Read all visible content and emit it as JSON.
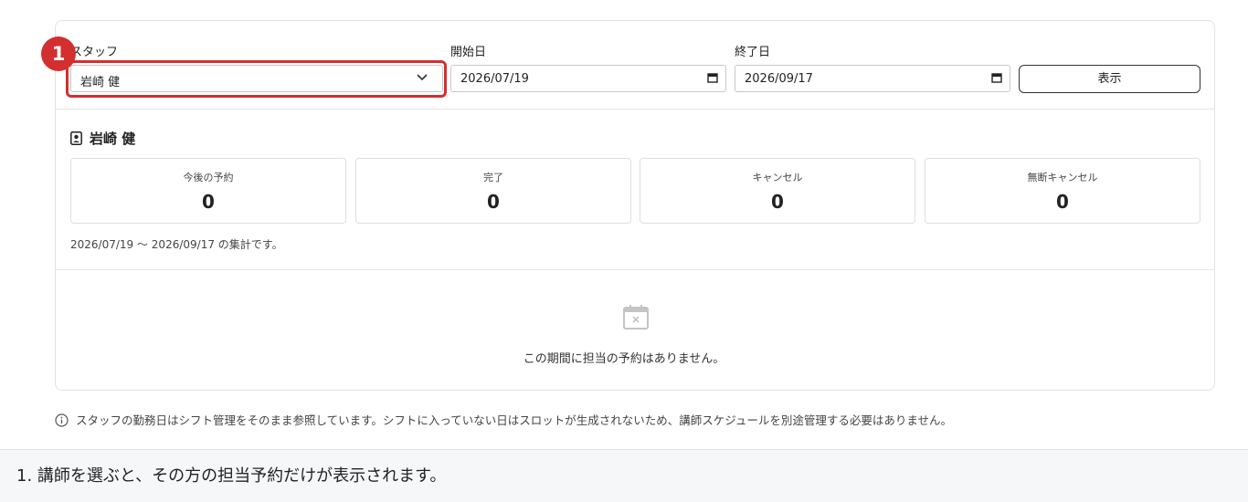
{
  "filters": {
    "staff_label": "スタッフ",
    "staff_value": "岩崎 健",
    "start_label": "開始日",
    "start_value": "2026/07/19",
    "end_label": "終了日",
    "end_value": "2026/09/17",
    "show_button": "表示"
  },
  "step_badge": "1",
  "staff": {
    "name": "岩崎 健"
  },
  "stats": [
    {
      "label": "今後の予約",
      "value": "0"
    },
    {
      "label": "完了",
      "value": "0"
    },
    {
      "label": "キャンセル",
      "value": "0"
    },
    {
      "label": "無断キャンセル",
      "value": "0"
    }
  ],
  "summary": "2026/07/19 〜 2026/09/17 の集計です。",
  "empty_message": "この期間に担当の予約はありません。",
  "note": "スタッフの勤務日はシフト管理をそのまま参照しています。シフトに入っていない日はスロットが生成されないため、講師スケジュールを別途管理する必要はありません。",
  "caption": "1. 講師を選ぶと、その方の担当予約だけが表示されます。",
  "colors": {
    "highlight": "#d32f2f",
    "border": "#e3e3e3"
  }
}
